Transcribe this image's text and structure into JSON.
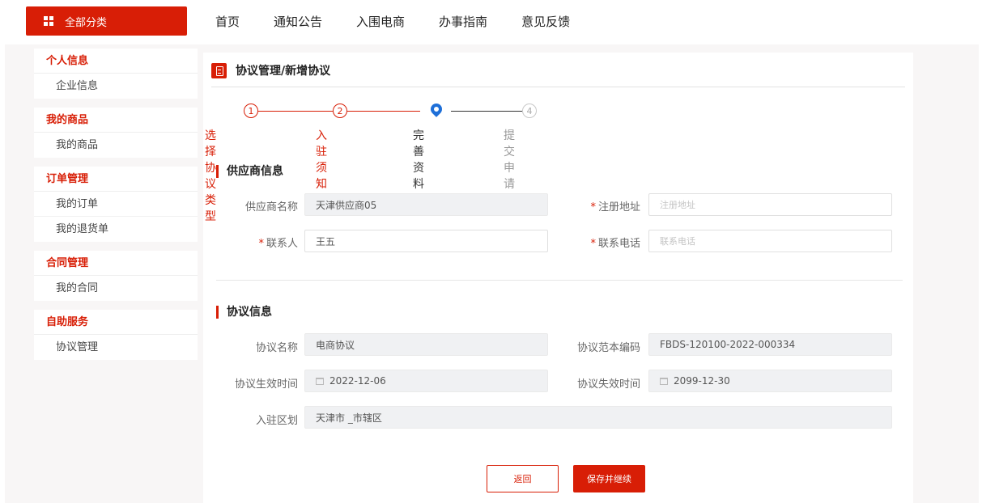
{
  "topnav": {
    "category_button": "全部分类",
    "links": [
      "首页",
      "通知公告",
      "入围电商",
      "办事指南",
      "意见反馈"
    ]
  },
  "sidebar": {
    "groups": [
      {
        "title": "个人信息",
        "items": [
          "企业信息"
        ]
      },
      {
        "title": "我的商品",
        "items": [
          "我的商品"
        ]
      },
      {
        "title": "订单管理",
        "items": [
          "我的订单",
          "我的退货单"
        ]
      },
      {
        "title": "合同管理",
        "items": [
          "我的合同"
        ]
      },
      {
        "title": "自助服务",
        "items": [
          "协议管理"
        ]
      }
    ]
  },
  "page": {
    "title": "协议管理/新增协议"
  },
  "steps": [
    {
      "number": "1",
      "label": "选择协议类型",
      "status": "done"
    },
    {
      "number": "2",
      "label": "入驻须知",
      "status": "done"
    },
    {
      "number": "3",
      "label": "完善资料",
      "status": "current"
    },
    {
      "number": "4",
      "label": "提交申请",
      "status": "todo"
    }
  ],
  "supplier": {
    "section_title": "供应商信息",
    "name_label": "供应商名称",
    "name_value": "天津供应商05",
    "address_label": "注册地址",
    "address_placeholder": "注册地址",
    "contact_label": "联系人",
    "contact_value": "王五",
    "phone_label": "联系电话",
    "phone_placeholder": "联系电话"
  },
  "agreement": {
    "section_title": "协议信息",
    "name_label": "协议名称",
    "name_value": "电商协议",
    "code_label": "协议范本编码",
    "code_value": "FBDS-120100-2022-000334",
    "start_label": "协议生效时间",
    "start_value": "2022-12-06",
    "end_label": "协议失效时间",
    "end_value": "2099-12-30",
    "region_label": "入驻区划",
    "region_value": "天津市 _市辖区"
  },
  "actions": {
    "back_label": "返回",
    "save_label": "保存并继续"
  },
  "colors": {
    "accent": "#d81e06",
    "current_step": "#1e6fd8"
  }
}
